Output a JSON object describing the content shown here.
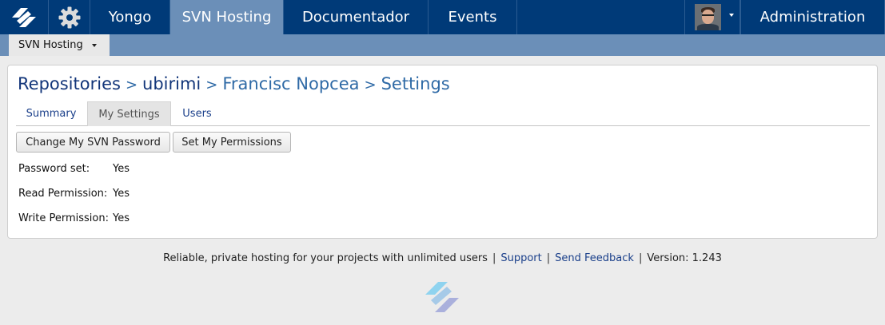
{
  "topbar": {
    "logo_icon": "yongo-logo-icon",
    "settings_icon": "gear-icon",
    "nav": [
      {
        "label": "Yongo",
        "active": false
      },
      {
        "label": "SVN Hosting",
        "active": true
      },
      {
        "label": "Documentador",
        "active": false
      },
      {
        "label": "Events",
        "active": false
      }
    ],
    "user_menu_icon": "caret-down-icon",
    "admin_label": "Administration",
    "bar_color": "#003a78",
    "active_color": "#6b8fb8"
  },
  "subbar": {
    "menu_label": "SVN Hosting",
    "menu_icon": "caret-down-icon"
  },
  "breadcrumb": {
    "repositories": "Repositories",
    "sep1": ">",
    "project": "ubirimi",
    "sep2": ">",
    "user": "Francisc Nopcea",
    "sep3": ">",
    "page": "Settings"
  },
  "tabs": [
    {
      "label": "Summary",
      "active": false
    },
    {
      "label": "My Settings",
      "active": true
    },
    {
      "label": "Users",
      "active": false
    }
  ],
  "actions": {
    "change_password": "Change My SVN Password",
    "set_permissions": "Set My Permissions"
  },
  "settings": [
    {
      "label": "Password set:",
      "value": "Yes"
    },
    {
      "label": "Read Permission:",
      "value": "Yes"
    },
    {
      "label": "Write Permission:",
      "value": "Yes"
    }
  ],
  "footer": {
    "tagline": "Reliable, private hosting for your projects with unlimited users",
    "sep": "|",
    "support": "Support",
    "feedback": "Send Feedback",
    "version": "Version: 1.243",
    "logo_icon": "yongo-footer-logo-icon"
  }
}
